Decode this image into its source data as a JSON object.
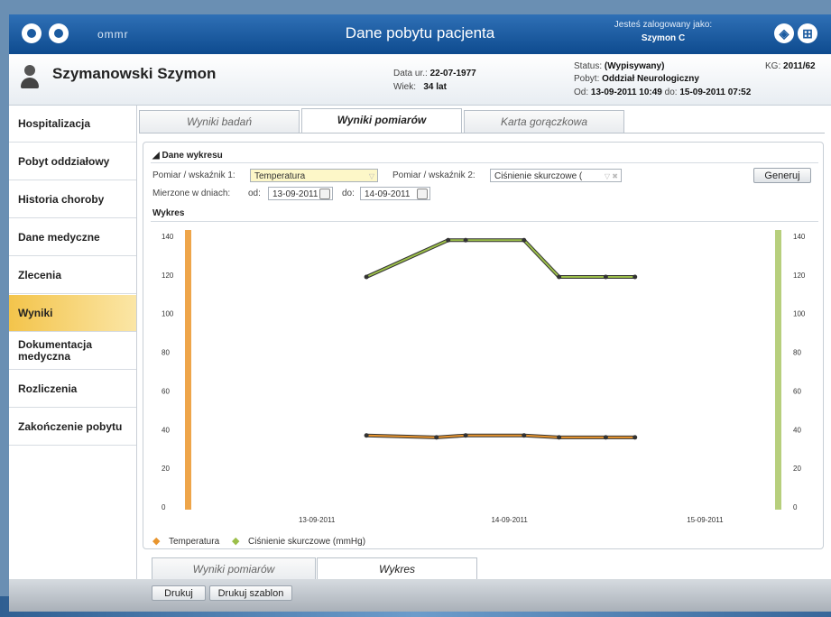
{
  "header": {
    "brand": "ommr",
    "title": "Dane pobytu pacjenta",
    "login_label": "Jesteś zalogowany jako:",
    "login_user": "Szymon C"
  },
  "patient": {
    "name": "Szymanowski Szymon",
    "dob_label": "Data ur.:",
    "dob": "22-07-1977",
    "age_label": "Wiek:",
    "age": "34 lat",
    "status_label": "Status:",
    "status": "(Wypisywany)",
    "stay_label": "Pobyt:",
    "stay": "Oddział Neurologiczny",
    "from_label": "Od:",
    "from": "13-09-2011  10:49",
    "to_label": "do:",
    "to": "15-09-2011  07:52",
    "kg_label": "KG:",
    "kg": "2011/62"
  },
  "sidebar": {
    "items": [
      {
        "label": "Hospitalizacja"
      },
      {
        "label": "Pobyt oddziałowy"
      },
      {
        "label": "Historia choroby"
      },
      {
        "label": "Dane medyczne"
      },
      {
        "label": "Zlecenia"
      },
      {
        "label": "Wyniki"
      },
      {
        "label": "Dokumentacja medyczna"
      },
      {
        "label": "Rozliczenia"
      },
      {
        "label": "Zakończenie pobytu"
      }
    ],
    "active": "Wyniki"
  },
  "tabs": [
    "Wyniki badań",
    "Wyniki pomiarów",
    "Karta gorączkowa"
  ],
  "form": {
    "section_title": "Dane wykresu",
    "measure1_label": "Pomiar / wskaźnik 1:",
    "measure1_value": "Temperatura",
    "measure2_label": "Pomiar / wskaźnik 2:",
    "measure2_value": "Ciśnienie skurczowe (",
    "generate_label": "Generuj",
    "days_label": "Mierzone w dniach:",
    "from_label": "od:",
    "from_value": "13-09-2011",
    "to_label": "do:",
    "to_value": "14-09-2011",
    "chart_title": "Wykres"
  },
  "bottom_tabs": [
    "Wyniki pomiarów",
    "Wykres"
  ],
  "buttons": {
    "print": "Drukuj",
    "print_template": "Drukuj szablon"
  },
  "colors": {
    "temperature": "#e8952e",
    "pressure": "#9cbf4a",
    "accent": "#1b5ba0",
    "active_nav": "#f3c44b"
  },
  "chart_data": {
    "type": "line",
    "x_ticks": [
      "13-09-2011",
      "14-09-2011",
      "15-09-2011"
    ],
    "y_ticks": [
      0,
      20,
      40,
      60,
      80,
      100,
      120,
      140
    ],
    "ylim": [
      0,
      140
    ],
    "series": [
      {
        "name": "Temperatura",
        "color": "#e8952e",
        "x": [
          0.3,
          0.42,
          0.47,
          0.57,
          0.63,
          0.71,
          0.76
        ],
        "y": [
          37,
          36,
          37,
          37,
          36,
          36,
          36
        ]
      },
      {
        "name": "Ciśnienie skurczowe (mmHg)",
        "color": "#9cbf4a",
        "x": [
          0.3,
          0.44,
          0.47,
          0.57,
          0.63,
          0.71,
          0.76
        ],
        "y": [
          119,
          138,
          138,
          138,
          119,
          119,
          119
        ]
      }
    ]
  }
}
